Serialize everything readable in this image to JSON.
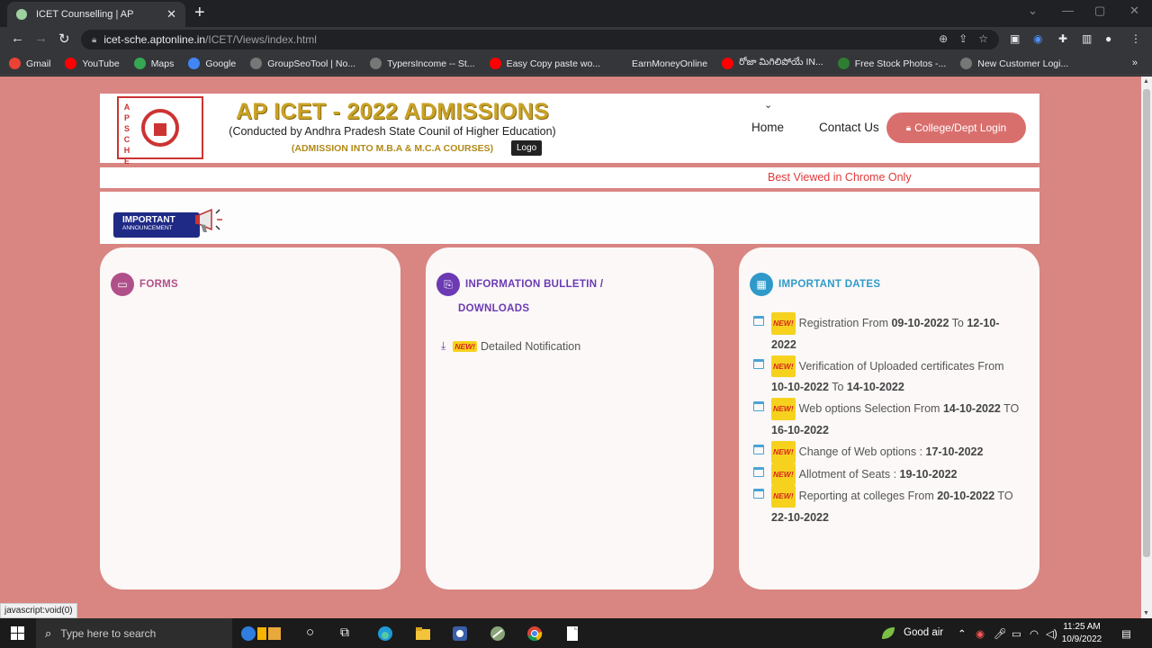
{
  "browser": {
    "tab_title": "ICET Counselling | AP",
    "url_host": "icet-sche.aptonline.in",
    "url_path": "/ICET/Views/index.html",
    "bookmarks": [
      {
        "label": "Gmail",
        "icon": "google-icon",
        "color": "#ea4335"
      },
      {
        "label": "YouTube",
        "icon": "youtube-icon",
        "color": "#ff0000"
      },
      {
        "label": "Maps",
        "icon": "maps-icon",
        "color": "#34a853"
      },
      {
        "label": "Google",
        "icon": "google-icon",
        "color": "#4285f4"
      },
      {
        "label": "GroupSeoTool | No...",
        "icon": "globe-icon",
        "color": "#777777"
      },
      {
        "label": "TypersIncome -- St...",
        "icon": "globe-icon",
        "color": "#777777"
      },
      {
        "label": "Easy Copy paste wo...",
        "icon": "youtube-icon",
        "color": "#ff0000"
      },
      {
        "label": "EarnMoneyOnline",
        "icon": "blank-icon",
        "color": "#35363a"
      },
      {
        "label": "రోజా మిగిలిపోయే IN...",
        "icon": "youtube-icon",
        "color": "#ff0000"
      },
      {
        "label": "Free Stock Photos -...",
        "icon": "image-icon",
        "color": "#2e7d32"
      },
      {
        "label": "New Customer Logi...",
        "icon": "globe-icon",
        "color": "#777777"
      }
    ],
    "more_bookmarks": "»",
    "status_text": "javascript:void(0)"
  },
  "header": {
    "logo_vertical_text": "APSCHE",
    "title": "AP ICET - 2022 ADMISSIONS",
    "subtitle": "(Conducted by Andhra Pradesh State Counil of Higher Education)",
    "subtitle2": "(ADMISSION INTO M.B.A & M.C.A COURSES)",
    "tooltip": "Logo",
    "nav_home": "Home",
    "nav_contact": "Contact Us",
    "login_label": "College/Dept Login"
  },
  "marquee": "Best Viewed in Chrome Only",
  "announcement": {
    "line1": "IMPORTANT",
    "line2": "ANNOUNCEMENT"
  },
  "new_tag": "NEW!",
  "cards": {
    "forms": {
      "title": "FORMS",
      "color": "#b0508a"
    },
    "bulletin": {
      "title_line1": "INFORMATION BULLETIN /",
      "title_line2": "DOWNLOADS",
      "color": "#6c3ab3",
      "items": [
        {
          "label": "Detailed Notification"
        }
      ]
    },
    "dates": {
      "title": "IMPORTANT DATES",
      "color": "#2f9ac9",
      "items": [
        {
          "pre": "Registration From ",
          "b1": "09-10-2022",
          "mid": " To ",
          "b2": "12-10-2022"
        },
        {
          "pre": "Verification of Uploaded certificates From ",
          "b1": "10-10-2022",
          "mid": " To ",
          "b2": "14-10-2022"
        },
        {
          "pre": "Web options Selection From ",
          "b1": "14-10-2022",
          "mid": " TO ",
          "b2": "16-10-2022"
        },
        {
          "pre": "Change of Web options : ",
          "b1": "17-10-2022",
          "mid": "",
          "b2": ""
        },
        {
          "pre": "Allotment of Seats : ",
          "b1": "19-10-2022",
          "mid": "",
          "b2": ""
        },
        {
          "pre": "Reporting at colleges From ",
          "b1": "20-10-2022",
          "mid": " TO ",
          "b2": "22-10-2022"
        }
      ]
    }
  },
  "taskbar": {
    "search_placeholder": "Type here to search",
    "weather": "Good air",
    "time": "11:25 AM",
    "date": "10/9/2022"
  }
}
